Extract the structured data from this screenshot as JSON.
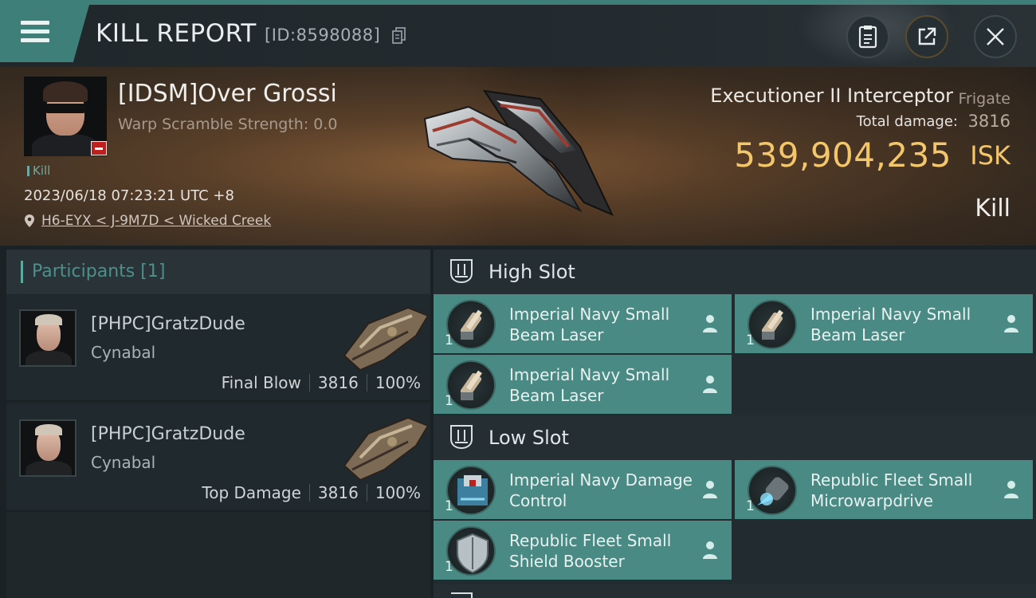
{
  "header": {
    "title": "KILL REPORT",
    "report_id": "[ID:8598088]"
  },
  "victim": {
    "name": "[IDSM]Over Grossi",
    "warp_scramble": "Warp Scramble Strength: 0.0",
    "tag": "Kill",
    "time": "2023/06/18 07:23:21 UTC +8",
    "location": "H6-EYX < J-9M7D < Wicked Creek",
    "ship_name": "Executioner II Interceptor",
    "ship_class": "Frigate",
    "total_damage_label": "Total damage:",
    "total_damage": "3816",
    "isk_value": "539,904,235",
    "isk_unit": "ISK",
    "result": "Kill"
  },
  "participants": {
    "title": "Participants",
    "count": "[1]",
    "items": [
      {
        "name": "[PHPC]GratzDude",
        "ship": "Cynabal",
        "role": "Final Blow",
        "damage": "3816",
        "percent": "100%"
      },
      {
        "name": "[PHPC]GratzDude",
        "ship": "Cynabal",
        "role": "Top Damage",
        "damage": "3816",
        "percent": "100%"
      }
    ]
  },
  "fitting": {
    "high_slot": {
      "label": "High Slot",
      "modules": [
        {
          "name": "Imperial Navy Small Beam Laser",
          "qty": "1",
          "icon": "beam-laser-icon"
        },
        {
          "name": "Imperial Navy Small Beam Laser",
          "qty": "1",
          "icon": "beam-laser-icon"
        },
        {
          "name": "Imperial Navy Small Beam Laser",
          "qty": "1",
          "icon": "beam-laser-icon"
        }
      ]
    },
    "low_slot": {
      "label": "Low Slot",
      "modules": [
        {
          "name": "Imperial Navy Damage Control",
          "qty": "1",
          "icon": "damage-control-icon"
        },
        {
          "name": "Republic Fleet Small Microwarpdrive",
          "qty": "1",
          "icon": "microwarpdrive-icon"
        },
        {
          "name": "Republic Fleet Small Shield Booster",
          "qty": "1",
          "icon": "shield-booster-icon"
        }
      ]
    }
  },
  "colors": {
    "accent_teal": "#4a8a84",
    "isk_gold": "#f4c66b",
    "alert_red": "#c0201d"
  }
}
